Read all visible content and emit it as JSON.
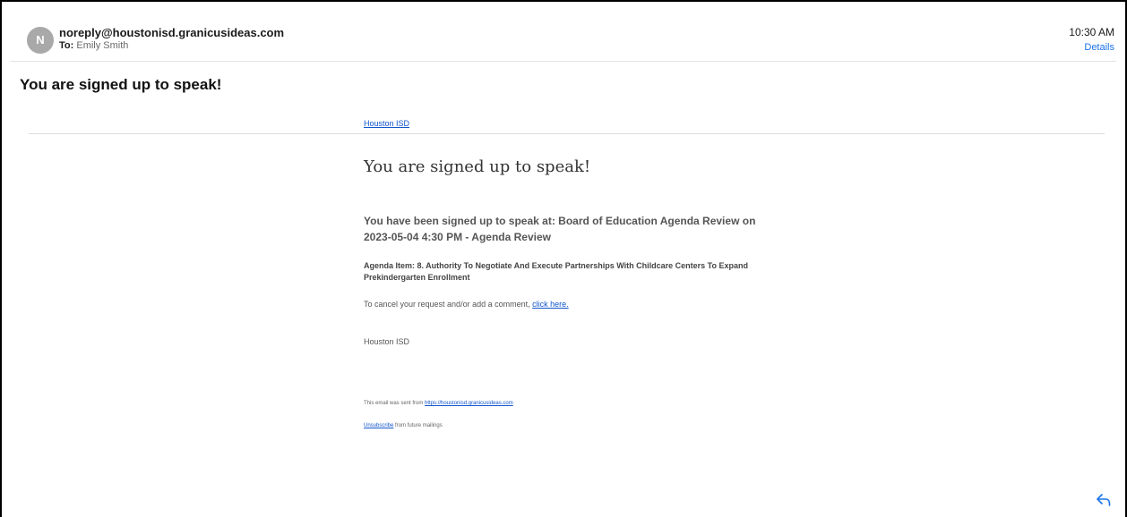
{
  "header": {
    "avatar_letter": "N",
    "sender": "noreply@houstonisd.granicusideas.com",
    "to_label": "To:",
    "to_name": "Emily Smith",
    "time": "10:30 AM",
    "details_label": "Details"
  },
  "subject": "You are signed up to speak!",
  "body": {
    "brand_link": "Houston ISD",
    "heading": "You are signed up to speak!",
    "signed_up_text": "You have been signed up to speak at: Board of Education Agenda Review on 2023-05-04 4:30 PM - Agenda Review",
    "agenda_item": "Agenda Item: 8. Authority To Negotiate And Execute Partnerships With Childcare Centers To Expand Prekindergarten Enrollment",
    "cancel_text": "To cancel your request and/or add a comment,",
    "cancel_link": "click here.",
    "signature": "Houston ISD",
    "footer_sent_text": "This email was sent from",
    "footer_sent_link": "https://houstonisd.granicusideas.com",
    "unsubscribe_link": "Unsubscribe",
    "unsubscribe_text": "from future mailings"
  },
  "icons": {
    "avatar": "avatar",
    "reply": "reply-icon"
  },
  "colors": {
    "link": "#1155cc",
    "accent": "#1a73e8",
    "avatar_bg": "#a9a9a9"
  }
}
